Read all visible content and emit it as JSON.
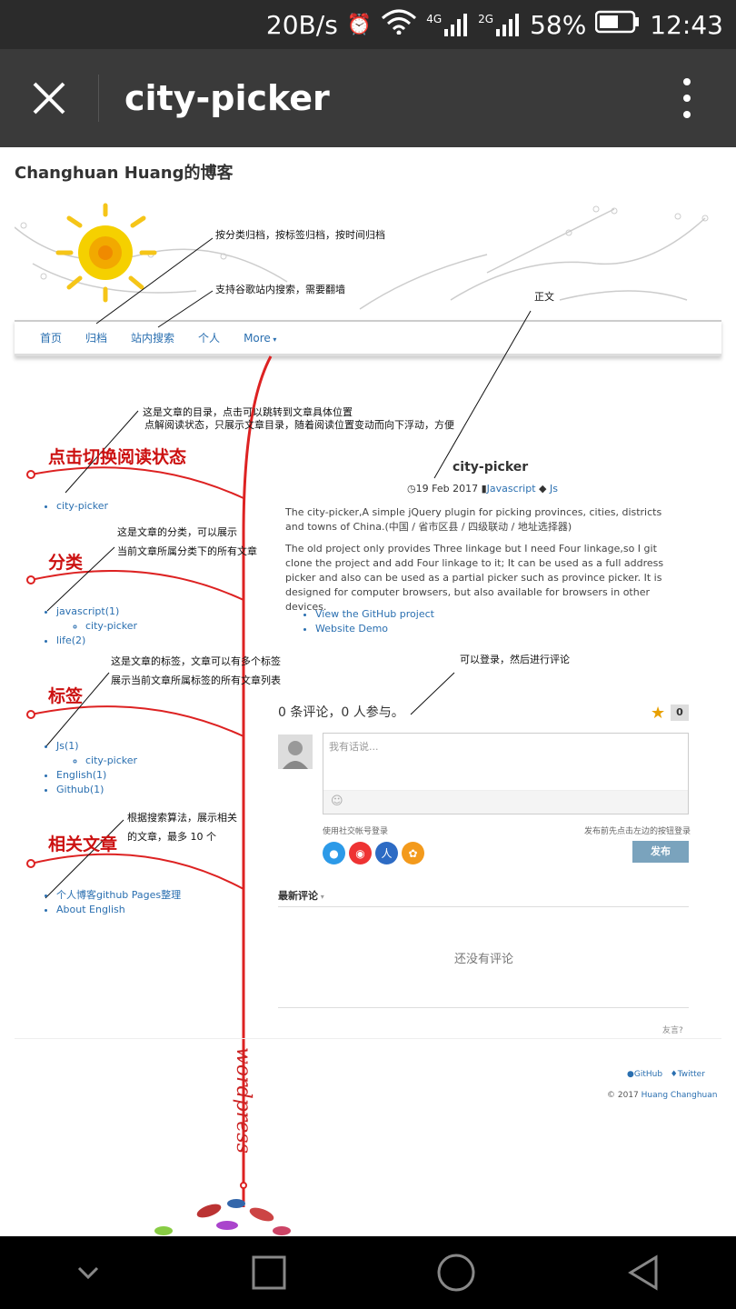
{
  "status": {
    "net_speed": "20B/s",
    "net_4g": "4G",
    "net_2g": "2G",
    "battery": "58%",
    "time": "12:43"
  },
  "appbar": {
    "title": "city-picker"
  },
  "blog": {
    "title": "Changhuan Huang的博客",
    "nav": [
      "首页",
      "归档",
      "站内搜索",
      "个人",
      "More"
    ],
    "toc_label": "点击切换阅读状态",
    "toc_items": [
      "city-picker"
    ],
    "category_label": "分类",
    "category_items": [
      "javascript(1)",
      "city-picker",
      "life(2)"
    ],
    "tag_label": "标签",
    "tag_items": [
      "Js(1)",
      "city-picker",
      "English(1)",
      "Github(1)"
    ],
    "related_label": "相关文章",
    "related_items": [
      "个人博客github Pages整理",
      "About English"
    ],
    "watermark": "wordpress"
  },
  "annotations": {
    "archive": "按分类归档，按标签归档，按时间归档",
    "search": "支持谷歌站内搜索，需要翻墙",
    "body": "正文",
    "toc_1": "这是文章的目录，点击可以跳转到文章具体位置",
    "toc_2": "点解阅读状态，只展示文章目录，随着阅读位置变动而向下浮动，方便",
    "cat_1": "这是文章的分类，可以展示",
    "cat_2": "当前文章所属分类下的所有文章",
    "tag_1": "这是文章的标签，文章可以有多个标签",
    "tag_2": "展示当前文章所属标签的所有文章列表",
    "login": "可以登录，然后进行评论",
    "rel_1": "根据搜索算法，展示相关",
    "rel_2": "的文章，最多 10 个"
  },
  "post": {
    "title": "city-picker",
    "date": "19 Feb 2017",
    "category": "Javascript",
    "tag": "Js",
    "para1": "The city-picker,A simple jQuery plugin for picking provinces, cities, districts and towns of China.(中国 / 省市区县 / 四级联动 / 地址选择器)",
    "para2": "The old project only provides Three linkage but I need Four linkage,so I git clone the project and add Four linkage to it; It can be used as a full address picker and also can be used as a partial picker such as province picker. It is designed for computer browsers, but also available for browsers in other devices.",
    "links": [
      "View the GitHub project",
      "Website Demo"
    ]
  },
  "comments": {
    "heading": "0 条评论，0 人参与。",
    "star_count": "0",
    "placeholder": "我有话说...",
    "social_login": "使用社交帐号登录",
    "hint": "发布前先点击左边的按钮登录",
    "publish": "发布",
    "latest": "最新评论",
    "empty": "还没有评论",
    "brand": "友言?"
  },
  "footer": {
    "github": "GitHub",
    "twitter": "Twitter",
    "copyright": "© 2017",
    "author": "Huang Changhuan"
  },
  "colors": {
    "annotation_red": "#cc1111",
    "link_blue": "#2a6fb0",
    "appbar": "#3a3a3a"
  }
}
